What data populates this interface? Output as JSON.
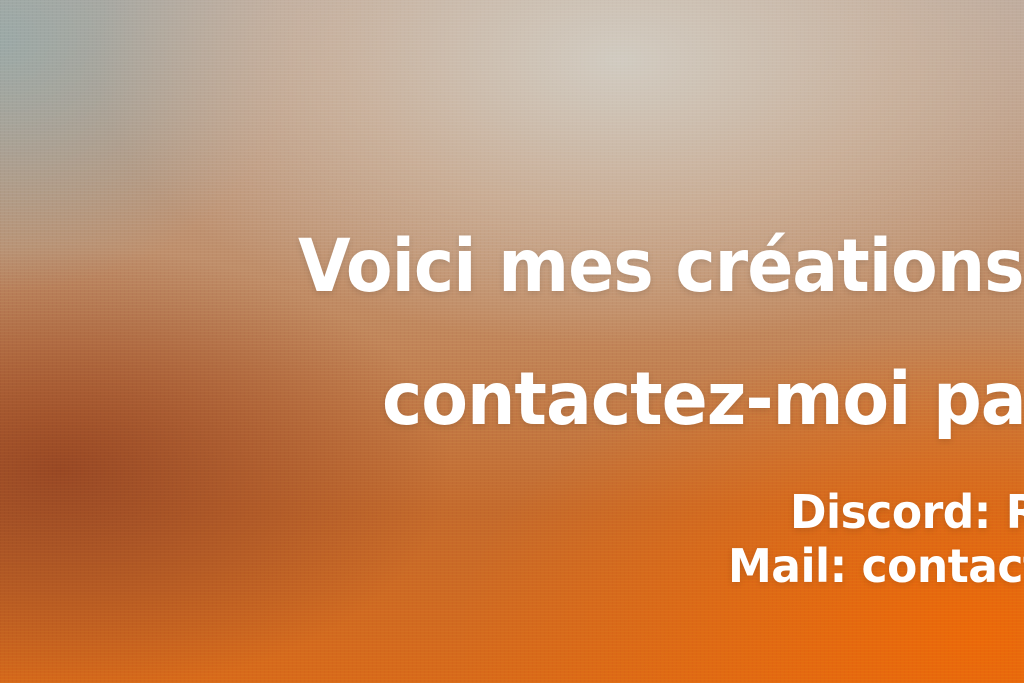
{
  "content": {
    "heading_line1": "Voici mes créations, s",
    "heading_line2": "contactez-moi par",
    "discord_line": "Discord: Rea",
    "mail_line": "Mail: contact@"
  },
  "colors": {
    "text": "#ffffff",
    "accent_orange": "#d86a1a",
    "top_light": "#d2cdc3"
  }
}
